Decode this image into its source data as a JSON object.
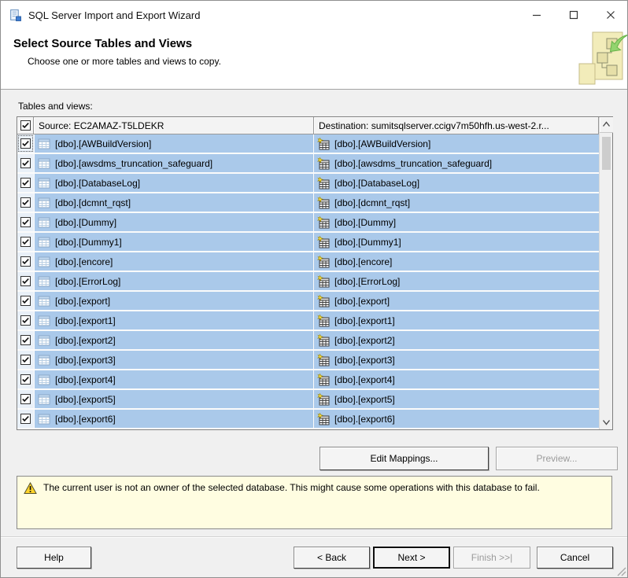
{
  "window": {
    "title": "SQL Server Import and Export Wizard"
  },
  "header": {
    "title": "Select Source Tables and Views",
    "subtitle": "Choose one or more tables and views to copy."
  },
  "main": {
    "tables_label": "Tables and views:",
    "grid": {
      "select_all_checked": true,
      "source_header": "Source: EC2AMAZ-T5LDEKR",
      "destination_header": "Destination: sumitsqlserver.ccigv7m50hfh.us-west-2.r...",
      "rows": [
        {
          "checked": true,
          "source": "[dbo].[AWBuildVersion]",
          "destination": "[dbo].[AWBuildVersion]"
        },
        {
          "checked": true,
          "source": "[dbo].[awsdms_truncation_safeguard]",
          "destination": "[dbo].[awsdms_truncation_safeguard]"
        },
        {
          "checked": true,
          "source": "[dbo].[DatabaseLog]",
          "destination": "[dbo].[DatabaseLog]"
        },
        {
          "checked": true,
          "source": "[dbo].[dcmnt_rqst]",
          "destination": "[dbo].[dcmnt_rqst]"
        },
        {
          "checked": true,
          "source": "[dbo].[Dummy]",
          "destination": "[dbo].[Dummy]"
        },
        {
          "checked": true,
          "source": "[dbo].[Dummy1]",
          "destination": "[dbo].[Dummy1]"
        },
        {
          "checked": true,
          "source": "[dbo].[encore]",
          "destination": "[dbo].[encore]"
        },
        {
          "checked": true,
          "source": "[dbo].[ErrorLog]",
          "destination": "[dbo].[ErrorLog]"
        },
        {
          "checked": true,
          "source": "[dbo].[export]",
          "destination": "[dbo].[export]"
        },
        {
          "checked": true,
          "source": "[dbo].[export1]",
          "destination": "[dbo].[export1]"
        },
        {
          "checked": true,
          "source": "[dbo].[export2]",
          "destination": "[dbo].[export2]"
        },
        {
          "checked": true,
          "source": "[dbo].[export3]",
          "destination": "[dbo].[export3]"
        },
        {
          "checked": true,
          "source": "[dbo].[export4]",
          "destination": "[dbo].[export4]"
        },
        {
          "checked": true,
          "source": "[dbo].[export5]",
          "destination": "[dbo].[export5]"
        },
        {
          "checked": true,
          "source": "[dbo].[export6]",
          "destination": "[dbo].[export6]"
        }
      ]
    },
    "edit_mappings_label": "Edit Mappings...",
    "preview_label": "Preview...",
    "warning_text": "The current user is not an owner of the selected database. This might cause some operations with this database to fail."
  },
  "footer": {
    "help_label": "Help",
    "back_label": "< Back",
    "next_label": "Next >",
    "finish_label": "Finish >>|",
    "cancel_label": "Cancel"
  },
  "icons": {
    "app": "wizard-app-icon",
    "minimize": "minimize-icon",
    "maximize": "maximize-icon",
    "close": "close-icon",
    "header_art": "import-export-diagram-icon",
    "source_table": "table-icon",
    "destination_table": "new-table-icon",
    "warning": "warning-triangle-icon",
    "scroll_up": "chevron-up-icon",
    "scroll_down": "chevron-down-icon",
    "resize": "resize-grip-icon"
  },
  "colors": {
    "row_selected": "#aac9ea",
    "warning_bg": "#fffde1",
    "header_bg": "#ffffff",
    "body_bg": "#f0f0f0",
    "disabled_text": "#9b9b9b"
  }
}
